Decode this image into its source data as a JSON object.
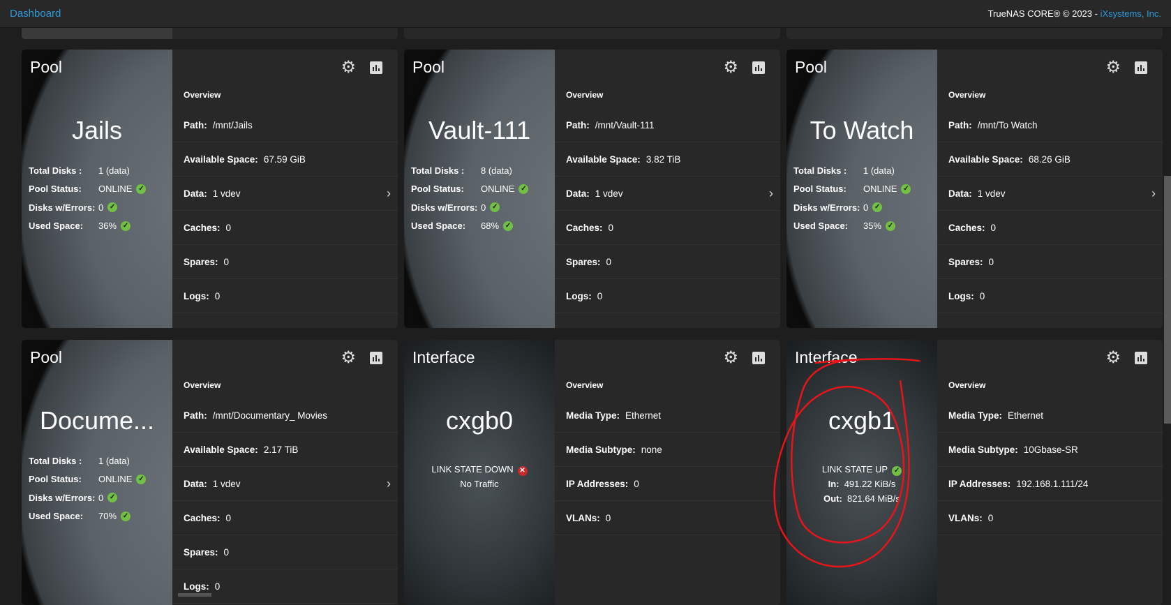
{
  "topbar": {
    "breadcrumb": "Dashboard",
    "copyright": "TrueNAS CORE® © 2023 - ",
    "company": "iXsystems, Inc."
  },
  "labels": {
    "overview": "Overview",
    "total_disks": "Total Disks :",
    "pool_status": "Pool Status:",
    "disks_errors": "Disks w/Errors:",
    "used_space": "Used Space:",
    "path": "Path:",
    "available": "Available Space:",
    "data": "Data:",
    "caches": "Caches:",
    "spares": "Spares:",
    "logs": "Logs:",
    "media_type": "Media Type:",
    "media_subtype": "Media Subtype:",
    "ip": "IP Addresses:",
    "vlans": "VLANs:",
    "in": "In:",
    "out": "Out:"
  },
  "pools": [
    {
      "type": "Pool",
      "name": "Jails",
      "total_disks": "1 (data)",
      "status": "ONLINE",
      "errors": "0",
      "used": "36%",
      "path": "/mnt/Jails",
      "available": "67.59 GiB",
      "data": "1 vdev",
      "caches": "0",
      "spares": "0",
      "logs": "0"
    },
    {
      "type": "Pool",
      "name": "Vault-111",
      "total_disks": "8 (data)",
      "status": "ONLINE",
      "errors": "0",
      "used": "68%",
      "path": "/mnt/Vault-111",
      "available": "3.82 TiB",
      "data": "1 vdev",
      "caches": "0",
      "spares": "0",
      "logs": "0"
    },
    {
      "type": "Pool",
      "name": "To Watch",
      "total_disks": "1 (data)",
      "status": "ONLINE",
      "errors": "0",
      "used": "35%",
      "path": "/mnt/To Watch",
      "available": "68.26 GiB",
      "data": "1 vdev",
      "caches": "0",
      "spares": "0",
      "logs": "0"
    },
    {
      "type": "Pool",
      "name": "Docume...",
      "total_disks": "1 (data)",
      "status": "ONLINE",
      "errors": "0",
      "used": "70%",
      "path": "/mnt/Documentary_ Movies",
      "available": "2.17 TiB",
      "data": "1 vdev",
      "caches": "0",
      "spares": "0",
      "logs": "0"
    }
  ],
  "interfaces": [
    {
      "type": "Interface",
      "name": "cxgb0",
      "link": "LINK STATE DOWN",
      "traffic": "No Traffic",
      "media_type": "Ethernet",
      "media_subtype": "none",
      "ip": "0",
      "vlans": "0"
    },
    {
      "type": "Interface",
      "name": "cxgb1",
      "link": "LINK STATE UP",
      "in": "491.22 KiB/s",
      "out": "821.64 MiB/s",
      "media_type": "Ethernet",
      "media_subtype": "10Gbase-SR",
      "ip": "192.168.1.111/24",
      "vlans": "0"
    }
  ],
  "colors": {
    "accent": "#2d9cdb",
    "ok": "#71bf44",
    "error": "#ce2929",
    "annotation": "#e8141a"
  }
}
